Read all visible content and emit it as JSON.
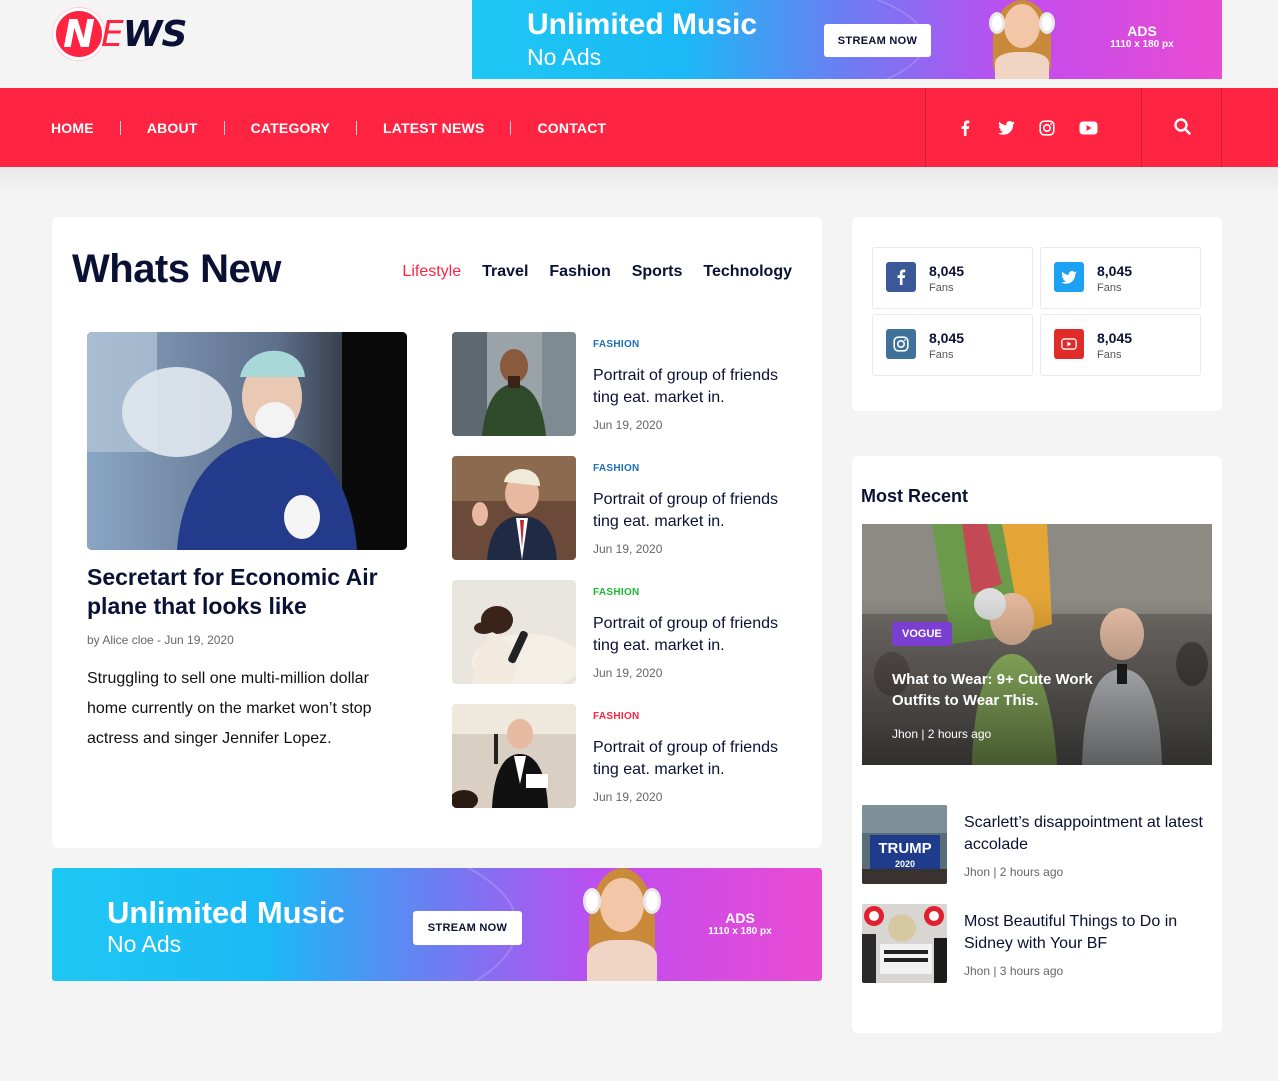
{
  "logo": {
    "first_letter": "N",
    "e": "E",
    "rest": "WS"
  },
  "top_ad": {
    "title": "Unlimited Music",
    "subtitle": "No Ads",
    "button": "STREAM NOW",
    "label": "ADS",
    "size": "1110 x 180 px"
  },
  "nav": {
    "items": [
      {
        "label": "HOME"
      },
      {
        "label": "ABOUT"
      },
      {
        "label": "CATEGORY"
      },
      {
        "label": "LATEST NEWS"
      },
      {
        "label": "CONTACT"
      }
    ],
    "social_icons": [
      "facebook-icon",
      "twitter-icon",
      "instagram-icon",
      "youtube-icon"
    ],
    "search_icon": "search-icon"
  },
  "colors": {
    "accent": "#ff2442",
    "navy": "#0b1035",
    "fashion_blue": "#1d6fb8",
    "fashion_green": "#1fb830",
    "fashion_red": "#ff2442",
    "vogue_purple": "#7a3fd0"
  },
  "whats_new": {
    "title": "Whats New",
    "tabs": [
      {
        "label": "Lifestyle",
        "active": true
      },
      {
        "label": "Travel"
      },
      {
        "label": "Fashion"
      },
      {
        "label": "Sports"
      },
      {
        "label": "Technology"
      }
    ],
    "feature": {
      "title": "Secretart for Economic Air plane that looks like",
      "meta": "by Alice cloe - Jun 19, 2020",
      "description": "Struggling to sell one multi-million dollar home currently on the market won’t stop actress and singer Jennifer Lopez."
    },
    "list": [
      {
        "category": "FASHION",
        "category_color": "#1d6fb8",
        "title": "Portrait of group of friends ting eat. market in.",
        "date": "Jun 19, 2020"
      },
      {
        "category": "FASHION",
        "category_color": "#1d6fb8",
        "title": "Portrait of group of friends ting eat. market in.",
        "date": "Jun 19, 2020"
      },
      {
        "category": "FASHION",
        "category_color": "#1fb830",
        "title": "Portrait of group of friends ting eat. market in.",
        "date": "Jun 19, 2020"
      },
      {
        "category": "FASHION",
        "category_color": "#ff2442",
        "title": "Portrait of group of friends ting eat. market in.",
        "date": "Jun 19, 2020"
      }
    ]
  },
  "fans": [
    {
      "network": "facebook",
      "icon": "facebook-icon",
      "color": "#3b5998",
      "count": "8,045",
      "label": "Fans"
    },
    {
      "network": "twitter",
      "icon": "twitter-icon",
      "color": "#1da1f2",
      "count": "8,045",
      "label": "Fans"
    },
    {
      "network": "instagram",
      "icon": "instagram-icon",
      "color": "#3f729b",
      "count": "8,045",
      "label": "Fans"
    },
    {
      "network": "youtube",
      "icon": "youtube-icon",
      "color": "#e12b28",
      "count": "8,045",
      "label": "Fans"
    }
  ],
  "most_recent": {
    "title": "Most Recent",
    "hero": {
      "badge": "VOGUE",
      "title": "What to Wear: 9+ Cute Work Outfits to Wear This.",
      "meta": "Jhon | 2 hours ago"
    },
    "items": [
      {
        "title": "Scarlett’s disappointment at latest accolade",
        "meta": "Jhon | 2 hours ago",
        "thumb_text": "TRUMP",
        "thumb_year": "2020"
      },
      {
        "title": "Most Beautiful Things to Do in Sidney with Your BF",
        "meta": "Jhon | 3 hours ago"
      }
    ]
  },
  "bottom_ad": {
    "title": "Unlimited Music",
    "subtitle": "No Ads",
    "button": "STREAM NOW",
    "label": "ADS",
    "size": "1110 x 180 px"
  }
}
